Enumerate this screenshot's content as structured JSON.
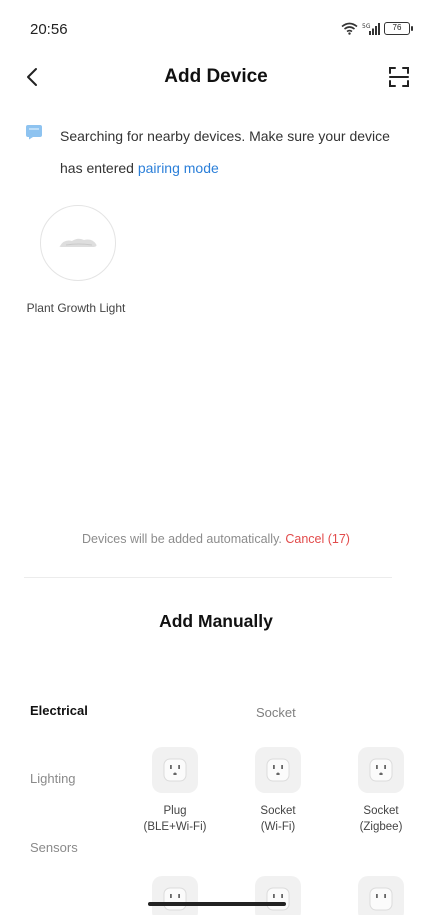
{
  "status_bar": {
    "time": "20:56",
    "battery": "76"
  },
  "header": {
    "title": "Add Device"
  },
  "search": {
    "text": "Searching for nearby devices. Make sure your device has entered ",
    "link": "pairing mode"
  },
  "found_devices": [
    {
      "name": "Plant Growth Light"
    }
  ],
  "auto_add": {
    "text": "Devices will be added automatically. ",
    "cancel": "Cancel (17)"
  },
  "manual": {
    "title": "Add Manually",
    "categories": [
      "Electrical",
      "Lighting",
      "Sensors"
    ],
    "section": "Socket",
    "products": [
      {
        "line1": "Plug",
        "line2": "(BLE+Wi-Fi)"
      },
      {
        "line1": "Socket",
        "line2": "(Wi-Fi)"
      },
      {
        "line1": "Socket",
        "line2": "(Zigbee)"
      }
    ]
  },
  "colors": {
    "link": "#2b7fd9",
    "cancel": "#e24b4b"
  }
}
